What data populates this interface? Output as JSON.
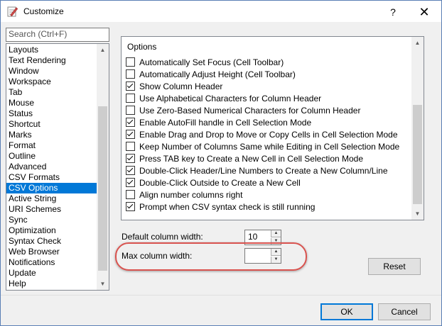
{
  "window": {
    "title": "Customize",
    "help": "?",
    "close": "✕"
  },
  "search": {
    "placeholder": "Search (Ctrl+F)"
  },
  "categories": [
    "Layouts",
    "Text Rendering",
    "Window",
    "Workspace",
    "Tab",
    "Mouse",
    "Status",
    "Shortcut",
    "Marks",
    "Format",
    "Outline",
    "Advanced",
    "CSV Formats",
    "CSV Options",
    "Active String",
    "URI Schemes",
    "Sync",
    "Optimization",
    "Syntax Check",
    "Web Browser",
    "Notifications",
    "Update",
    "Help"
  ],
  "selected_category": "CSV Options",
  "options_group": {
    "title": "Options",
    "items": [
      {
        "label": "Automatically Set Focus (Cell Toolbar)",
        "checked": false
      },
      {
        "label": "Automatically Adjust Height (Cell Toolbar)",
        "checked": false
      },
      {
        "label": "Show Column Header",
        "checked": true
      },
      {
        "label": "Use Alphabetical Characters for Column Header",
        "checked": false
      },
      {
        "label": "Use Zero-Based Numerical Characters for Column Header",
        "checked": false
      },
      {
        "label": "Enable AutoFill handle in Cell Selection Mode",
        "checked": true
      },
      {
        "label": "Enable Drag and Drop to Move or Copy Cells in Cell Selection Mode",
        "checked": true
      },
      {
        "label": "Keep Number of Columns Same while Editing in Cell Selection Mode",
        "checked": false
      },
      {
        "label": "Press TAB key to Create a New Cell in Cell Selection Mode",
        "checked": true
      },
      {
        "label": "Double-Click Header/Line Numbers to Create a New Column/Line",
        "checked": true
      },
      {
        "label": "Double-Click Outside to Create a New Cell",
        "checked": true
      },
      {
        "label": "Align number columns right",
        "checked": false
      },
      {
        "label": "Prompt when CSV syntax check is still running",
        "checked": true
      }
    ]
  },
  "default_width": {
    "label": "Default column width:",
    "value": "10"
  },
  "max_width": {
    "label": "Max column width:",
    "value": ""
  },
  "buttons": {
    "reset": "Reset",
    "ok": "OK",
    "cancel": "Cancel"
  },
  "colors": {
    "selection": "#0078d7",
    "highlight_ring": "#d9534f"
  }
}
